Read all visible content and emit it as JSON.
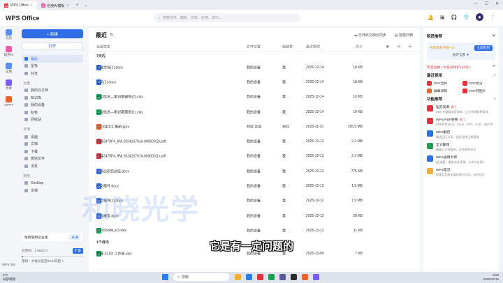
{
  "tabs": [
    {
      "label": "WPS Office",
      "logo": "W",
      "logo_color": "#e0353c"
    },
    {
      "label": "稻壳AI模板",
      "logo": "D",
      "logo_color": "#ef5ca6"
    }
  ],
  "header": {
    "brand": "WPS Office",
    "search_placeholder": "搜索文件、模板、文库、应用、技巧..."
  },
  "rail": [
    {
      "label": "日历"
    },
    {
      "label": "稻壳AI"
    },
    {
      "label": "应用"
    },
    {
      "label": "灵犀"
    },
    {
      "label": "AIPPT"
    }
  ],
  "rail_bottom": "WPS 365",
  "nav": {
    "new_label": "+ 新建",
    "open_label": "打开",
    "top_items": [
      {
        "label": "最近",
        "active": true
      },
      {
        "label": "星标",
        "active": false
      },
      {
        "label": "共享",
        "active": false
      }
    ],
    "cloud_head": "云盘",
    "cloud_items": [
      {
        "label": "我的云文档"
      },
      {
        "label": "知识库"
      },
      {
        "label": "我的设备"
      },
      {
        "label": "标签"
      },
      {
        "label": "回收站"
      }
    ],
    "local_head": "本地",
    "local_items": [
      {
        "label": "桌面"
      },
      {
        "label": "文档"
      },
      {
        "label": "下载"
      },
      {
        "label": "微信文件"
      },
      {
        "label": "浏览"
      }
    ],
    "common_head": "常用",
    "common_items": [
      {
        "label": "Desktop"
      },
      {
        "label": "文档"
      }
    ],
    "promo": {
      "label": "免费使用企业版",
      "action": "开通"
    },
    "storage": {
      "label": "云空间：1.95G/1T",
      "expand": "扩容",
      "note": "限时：大会员低至¥0.4/日起 >",
      "used_fraction": 0.002
    }
  },
  "main": {
    "title": "最近",
    "action_sync": "已开启文档云同步",
    "action_organize": "智能归档",
    "columns": {
      "name": "全部类型",
      "location": "文件位置",
      "owner": "创建者",
      "date": "最近修改",
      "size": "大小"
    },
    "group_week": "7天内",
    "group_month": "1个月内",
    "files": [
      {
        "name": "新建文档(1).docx",
        "type": "W",
        "color": "#2f6ee6",
        "location": "我的设备",
        "owner": "我",
        "date": "2025-12-14",
        "size": "18 KB"
      },
      {
        "name": "意见(1).docx",
        "type": "W",
        "color": "#2f6ee6",
        "location": "我的设备",
        "owner": "我",
        "date": "2025-12-14",
        "size": "18 KB"
      },
      {
        "name": "分组信息—第18期最新(2).xlsx",
        "type": "S",
        "color": "#1f9d55",
        "location": "我的设备",
        "owner": "我",
        "date": "2025-12-14",
        "size": "10 KB"
      },
      {
        "name": "分组信息—第18期最新(1).xlsx",
        "type": "S",
        "color": "#1f9d55",
        "location": "我的设备",
        "owner": "我",
        "date": "2025-12-14",
        "size": "10 KB"
      },
      {
        "name": "2025演示汇报册.pptx",
        "type": "P",
        "color": "#e8622c",
        "location": "孙欣 共享",
        "owner": "孙欣",
        "date": "2025-11-10",
        "size": "195.5 MB"
      },
      {
        "name": "招募2470F4_IPA 2024157016-000000(2).pdf",
        "type": "P",
        "color": "#e0353c",
        "location": "我的设备",
        "owner": "我",
        "date": "2025-12-12",
        "size": "2.2 MB"
      },
      {
        "name": "招募2470F4_IPA 2024157016-000000(1).pdf",
        "type": "P",
        "color": "#e0353c",
        "location": "我的设备",
        "owner": "我",
        "date": "2025-12-12",
        "size": "2.2 MB"
      },
      {
        "name": "光谱仪研究总结.docx",
        "type": "W",
        "color": "#2f6ee6",
        "location": "我的设备",
        "owner": "我",
        "date": "2025-12-12",
        "size": "775 KB"
      },
      {
        "name": "中文稿件.docx",
        "type": "W",
        "color": "#2f6ee6",
        "location": "我的设备",
        "owner": "我",
        "date": "2025-12-12",
        "size": "1.9 MB"
      },
      {
        "name": "中文稿件(1).docx",
        "type": "W",
        "color": "#2f6ee6",
        "location": "我的设备",
        "owner": "我",
        "date": "2025-12-12",
        "size": "1.9 MB"
      },
      {
        "name": "开题报告.docx",
        "type": "W",
        "color": "#2f6ee6",
        "location": "我的设备",
        "owner": "我",
        "date": "2025-12-12",
        "size": "28 KB"
      },
      {
        "name": "LENS5MM_F3.xlsx",
        "type": "S",
        "color": "#1f9d55",
        "location": "我的设备",
        "owner": "我",
        "date": "2025-12-12",
        "size": "11 KB"
      }
    ],
    "month_files": [
      {
        "name": "新建 XLSX 工作表.xlsx",
        "type": "S",
        "color": "#1f9d55",
        "location": "我的设备",
        "owner": "我",
        "date": "2025-12-09",
        "size": "7 KB"
      }
    ]
  },
  "right": {
    "title": "院员推荐",
    "vip_left": "今日签到 积分 +2",
    "vip_btn": "立即签到",
    "vip_more": "展开全部 ▼",
    "year_line": "年度兑换 | 大会员特价149元>",
    "tools_head": "最近使用",
    "tools": [
      {
        "label": "PDF合并"
      },
      {
        "label": "PDF拆分"
      },
      {
        "label": "屏幕录制"
      },
      {
        "label": "PDF转图片"
      }
    ],
    "features_head": "功能推荐",
    "features": [
      {
        "title": "稻壳资源",
        "hot": "热门",
        "desc": "100+专题精选资源库，让文档排版更高效"
      },
      {
        "title": "WPS PDF转换",
        "hot": "热门",
        "desc": "PDF转为Word、Excel、PPT、CAD、图片等"
      },
      {
        "title": "WPS翻历",
        "hot": "",
        "desc": "精选日历分享，团队协作日程管理"
      },
      {
        "title": "全文翻译",
        "hot": "",
        "desc": "精确入文档翻译，支持多种语言"
      },
      {
        "title": "WPS通用大师",
        "hot": "",
        "desc": "(合通窗、重复文件清理、大文件处理)"
      },
      {
        "title": "WPS笔记",
        "hot": "",
        "desc": "轻量且功能丰富的笔记应用，实时同步"
      }
    ]
  },
  "overlay": {
    "watermark": "和晓光学",
    "subtitle": "它是有一定问题的"
  },
  "taskbar": {
    "weather_temp": "3°C",
    "weather_desc": "局部晴朗",
    "search_label": "搜索",
    "time": "9:06",
    "date": "2025/12/16"
  }
}
